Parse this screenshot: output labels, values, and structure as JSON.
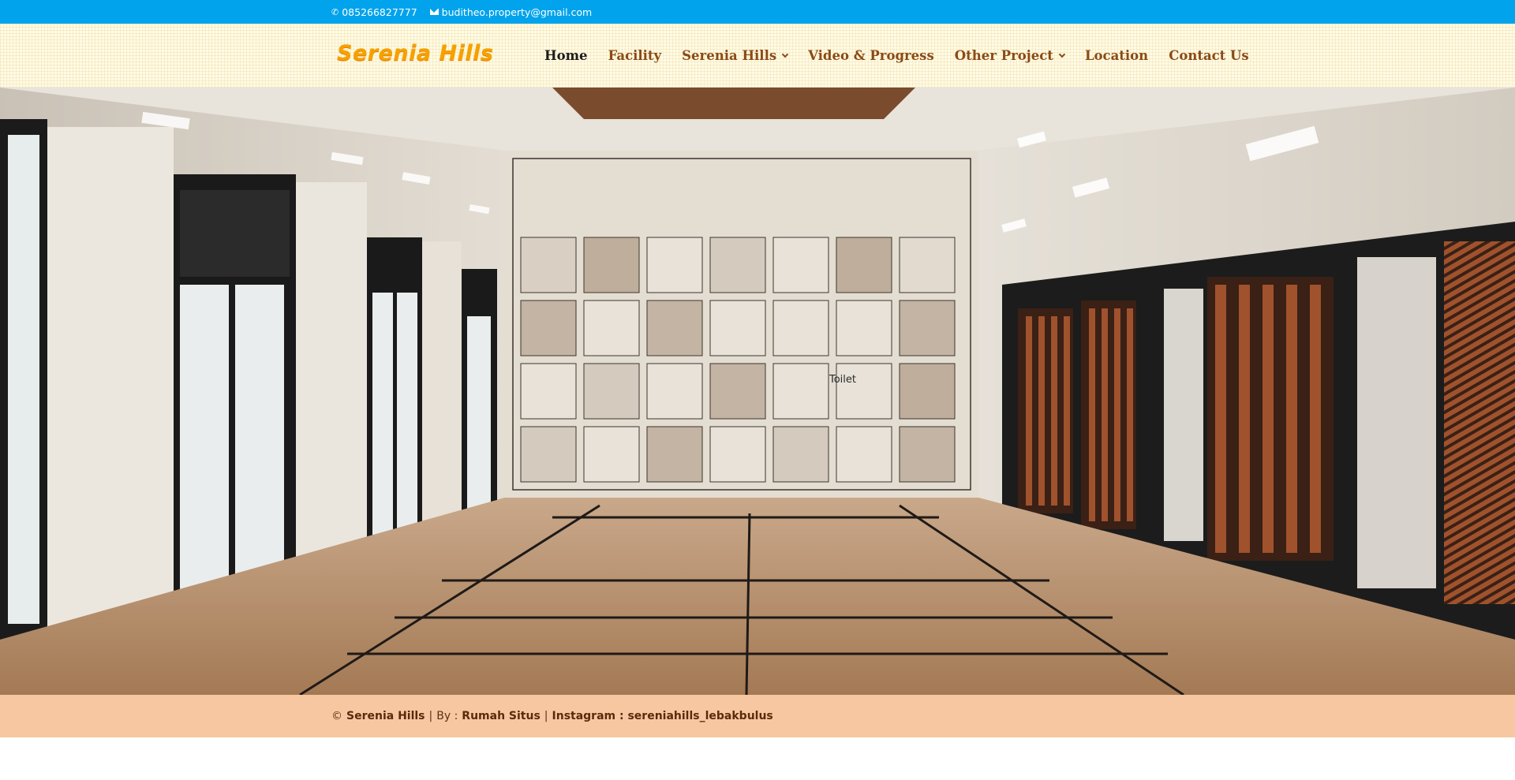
{
  "topbar": {
    "phone": "085266827777",
    "email": "buditheo.property@gmail.com",
    "email_icon": "envelope-icon"
  },
  "header": {
    "logo_text": "Serenia Hills",
    "nav": [
      {
        "label": "Home",
        "active": true,
        "has_dropdown": false
      },
      {
        "label": "Facility",
        "active": false,
        "has_dropdown": false
      },
      {
        "label": "Serenia Hills",
        "active": false,
        "has_dropdown": true
      },
      {
        "label": "Video & Progress",
        "active": false,
        "has_dropdown": false
      },
      {
        "label": "Other Project",
        "active": false,
        "has_dropdown": true
      },
      {
        "label": "Location",
        "active": false,
        "has_dropdown": false
      },
      {
        "label": "Contact Us",
        "active": false,
        "has_dropdown": false
      }
    ]
  },
  "hero": {
    "sign_text": "Toilet"
  },
  "footer": {
    "copyright_symbol": "©",
    "site_name": "Serenia Hills",
    "sep1": "|",
    "by_label": "By :",
    "by_name": "Rumah Situs",
    "sep2": "|",
    "instagram": "Instagram : sereniahills_lebakbulus"
  },
  "colors": {
    "topbar_bg": "#00a3ec",
    "nav_text": "#8a4a16",
    "nav_active": "#1c1c1c",
    "logo": "#f6a100",
    "footer_bg": "#f6c7a0"
  }
}
